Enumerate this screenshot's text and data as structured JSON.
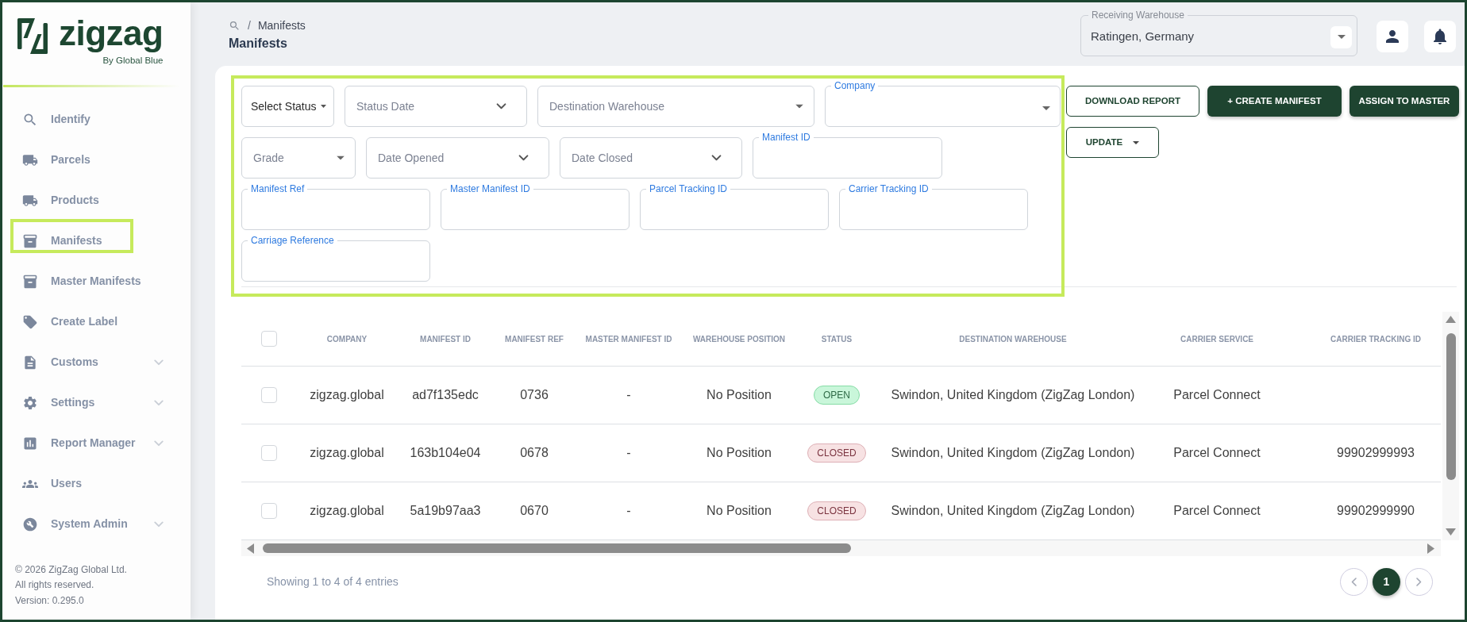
{
  "sidebar": {
    "logo": {
      "wordmark": "zigzag",
      "tagline": "By Global Blue"
    },
    "items": [
      {
        "label": "Identify",
        "expandable": false,
        "highlighted": false
      },
      {
        "label": "Parcels",
        "expandable": false,
        "highlighted": false
      },
      {
        "label": "Products",
        "expandable": false,
        "highlighted": false
      },
      {
        "label": "Manifests",
        "expandable": false,
        "highlighted": true
      },
      {
        "label": "Master Manifests",
        "expandable": false,
        "highlighted": false
      },
      {
        "label": "Create Label",
        "expandable": false,
        "highlighted": false
      },
      {
        "label": "Customs",
        "expandable": true,
        "highlighted": false
      },
      {
        "label": "Settings",
        "expandable": true,
        "highlighted": false
      },
      {
        "label": "Report Manager",
        "expandable": true,
        "highlighted": false
      },
      {
        "label": "Users",
        "expandable": false,
        "highlighted": false
      },
      {
        "label": "System Admin",
        "expandable": true,
        "highlighted": false
      }
    ],
    "footer_lines": [
      "© 2026 ZigZag Global Ltd.",
      "All rights reserved.",
      "Version: 0.295.0"
    ]
  },
  "header": {
    "breadcrumb": {
      "separator": "/",
      "items": [
        "Manifests"
      ]
    },
    "title": "Manifests",
    "receiving_warehouse": {
      "label": "Receiving Warehouse",
      "value": "Ratingen, Germany"
    }
  },
  "filters": {
    "highlighted": true,
    "rows": [
      [
        {
          "kind": "select",
          "value": "Select Status"
        },
        {
          "kind": "date",
          "placeholder": "Status Date"
        },
        {
          "kind": "dropdown",
          "placeholder": "Destination Warehouse"
        },
        {
          "kind": "dropdown",
          "label": "Company"
        }
      ],
      [
        {
          "kind": "dropdown",
          "placeholder": "Grade"
        },
        {
          "kind": "date",
          "placeholder": "Date Opened"
        },
        {
          "kind": "date",
          "placeholder": "Date Closed"
        },
        {
          "kind": "text",
          "label": "Manifest ID"
        }
      ],
      [
        {
          "kind": "text",
          "label": "Manifest Ref"
        },
        {
          "kind": "text",
          "label": "Master Manifest ID"
        },
        {
          "kind": "text",
          "label": "Parcel Tracking ID"
        },
        {
          "kind": "text",
          "label": "Carrier Tracking ID"
        }
      ],
      [
        {
          "kind": "text",
          "label": "Carriage Reference"
        }
      ]
    ]
  },
  "actions": [
    {
      "label": "DOWNLOAD REPORT",
      "kind": "outline"
    },
    {
      "label": "+ CREATE MANIFEST",
      "kind": "primary"
    },
    {
      "label": "ASSIGN TO MASTER",
      "kind": "primary"
    },
    {
      "label": "UPDATE",
      "kind": "menu"
    }
  ],
  "table": {
    "select_all": {
      "checked": false
    },
    "columns": [
      "COMPANY",
      "MANIFEST ID",
      "MANIFEST REF",
      "MASTER MANIFEST ID",
      "WAREHOUSE POSITION",
      "STATUS",
      "DESTINATION WAREHOUSE",
      "CARRIER SERVICE",
      "CARRIER TRACKING ID"
    ],
    "rows": [
      {
        "checked": false,
        "company": "zigzag.global",
        "manifest_id": "ad7f135edc",
        "manifest_ref": "0736",
        "master_manifest_id": "-",
        "warehouse_position": "No Position",
        "status": {
          "label": "OPEN",
          "kind": "open"
        },
        "destination_warehouse": "Swindon, United Kingdom (ZigZag London)",
        "carrier_service": "Parcel Connect"
      },
      {
        "checked": false,
        "company": "zigzag.global",
        "manifest_id": "163b104e04",
        "manifest_ref": "0678",
        "master_manifest_id": "-",
        "warehouse_position": "No Position",
        "status": {
          "label": "CLOSED",
          "kind": "closed"
        },
        "destination_warehouse": "Swindon, United Kingdom (ZigZag London)",
        "carrier_service": "Parcel Connect",
        "carrier_tracking_id": "99902999993"
      },
      {
        "checked": false,
        "company": "zigzag.global",
        "manifest_id": "5a19b97aa3",
        "manifest_ref": "0670",
        "master_manifest_id": "-",
        "warehouse_position": "No Position",
        "status": {
          "label": "CLOSED",
          "kind": "closed"
        },
        "destination_warehouse": "Swindon, United Kingdom (ZigZag London)",
        "carrier_service": "Parcel Connect",
        "carrier_tracking_id": "99902999990"
      }
    ],
    "summary": "Showing 1 to 4 of 4 entries",
    "pages": [
      {
        "label": "1",
        "selected": true
      }
    ]
  }
}
